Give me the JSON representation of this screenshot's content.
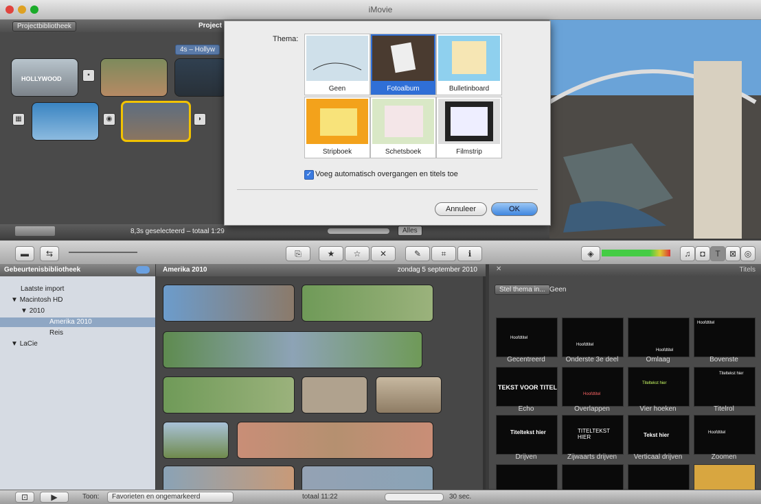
{
  "window": {
    "title": "iMovie"
  },
  "project": {
    "library_button": "Projectbibliotheek",
    "project_label": "Project",
    "clip_tag": "4s – Hollyw",
    "clip1_text": "HOLLYWOOD",
    "status": "8,3s geselecteerd – totaal 1:29",
    "zoom_label": "Alles"
  },
  "dialog": {
    "label": "Thema:",
    "themes": [
      {
        "name": "Geen",
        "selected": false
      },
      {
        "name": "Fotoalbum",
        "selected": true
      },
      {
        "name": "Bulletinboard",
        "selected": false
      },
      {
        "name": "Stripboek",
        "selected": false
      },
      {
        "name": "Schetsboek",
        "selected": false
      },
      {
        "name": "Filmstrip",
        "selected": false
      }
    ],
    "checkbox_label": "Voeg automatisch overgangen en titels toe",
    "checkbox_checked": true,
    "cancel": "Annuleer",
    "ok": "OK"
  },
  "events": {
    "header": "Gebeurtenisbibliotheek",
    "items": [
      {
        "label": "Laatste import"
      },
      {
        "label": "Macintosh HD"
      },
      {
        "label": "2010"
      },
      {
        "label": "Amerika 2010"
      },
      {
        "label": "Reis"
      },
      {
        "label": "LaCie"
      }
    ]
  },
  "browser": {
    "event_title": "Amerika 2010",
    "event_date": "zondag 5 september 2010"
  },
  "titles_panel": {
    "header": "Titels",
    "theme_button": "Stel thema in...",
    "theme_value": "Geen",
    "items": [
      "Gecentreerd",
      "Onderste 3e deel",
      "Omlaag",
      "Bovenste",
      "Echo",
      "Overlappen",
      "Vier hoeken",
      "Titelrol",
      "Drijven",
      "Zijwaarts drijven",
      "Verticaal drijven",
      "Zoomen"
    ],
    "thumb_texts": {
      "t1": "Hoofdtitel",
      "t2": "TITELTEKST HIER",
      "t3": "Tekst hier",
      "t4": "Titeltekst hier",
      "t5": "TEKST VOOR TITEL",
      "t6": "Titeltekst hier"
    }
  },
  "bottombar": {
    "show_label": "Toon:",
    "show_value": "Favorieten en ongemarkeerd",
    "total": "totaal 11:22",
    "duration": "30 sec."
  },
  "colors": {
    "selection": "#2f6fd6",
    "accent_yellow": "#f2c300"
  }
}
